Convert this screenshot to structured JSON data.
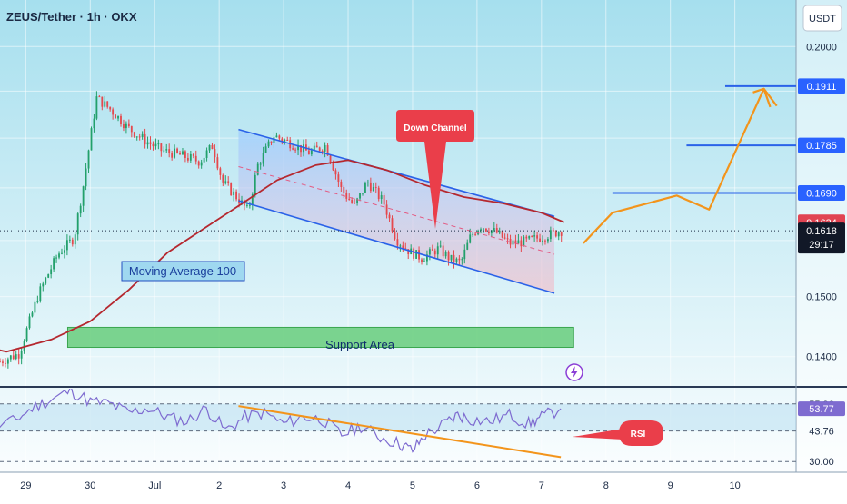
{
  "header": {
    "symbol_title": "ZEUS/Tether · 1h · OKX",
    "currency_button": "USDT"
  },
  "colors": {
    "background_top": "#a6dfee",
    "background_bottom": "#ffffff",
    "candle_up": "#22a06b",
    "candle_down": "#e5484d",
    "moving_average": "#b5282f",
    "channel_line": "#2a62e8",
    "channel_fill_top": "#9ecfff",
    "channel_fill_bottom": "#f5b9c4",
    "support_fill": "#6fcf83",
    "projection": "#f3941b",
    "rsi_line": "#7e6bd0",
    "callout_red": "#ea3e4a",
    "price_tag_red": "#e14452",
    "price_tag_blue": "#2962ff"
  },
  "annotations": {
    "down_channel": "Down Channel",
    "moving_average": "Moving Average 100",
    "support_area": "Support Area",
    "rsi": "RSI",
    "countdown": "29:17"
  },
  "chart_data": [
    {
      "type": "candlestick",
      "title": "ZEUS/Tether · 1h · OKX",
      "x_ticks": [
        "29",
        "30",
        "Jul",
        "2",
        "3",
        "4",
        "5",
        "6",
        "7",
        "8",
        "9",
        "10"
      ],
      "y_ticks": [
        "0.1400",
        "0.1500",
        "0.2000"
      ],
      "ylim": [
        0.1355,
        0.211
      ],
      "y_scale": "log",
      "grid": true,
      "price_levels": [
        {
          "label": "0.1911",
          "value": 0.1911,
          "style": "resistance-line"
        },
        {
          "label": "0.1785",
          "value": 0.1785,
          "style": "resistance-line"
        },
        {
          "label": "0.1690",
          "value": 0.169,
          "style": "resistance-line"
        },
        {
          "label": "0.1634",
          "value": 0.1634,
          "style": "moving-average-tag"
        },
        {
          "label": "0.1618",
          "value": 0.1618,
          "style": "last-price"
        }
      ],
      "close_path": [
        [
          28.6,
          0.1392
        ],
        [
          28.9,
          0.1405
        ],
        [
          29.2,
          0.1505
        ],
        [
          29.5,
          0.1575
        ],
        [
          29.75,
          0.1605
        ],
        [
          29.9,
          0.171
        ],
        [
          30.1,
          0.1885
        ],
        [
          30.3,
          0.1862
        ],
        [
          30.6,
          0.182
        ],
        [
          30.85,
          0.1795
        ],
        [
          31.1,
          0.1775
        ],
        [
          31.4,
          0.1765
        ],
        [
          31.7,
          0.1752
        ],
        [
          31.9,
          0.1785
        ],
        [
          32.05,
          0.1712
        ],
        [
          32.25,
          0.1685
        ],
        [
          32.45,
          0.1655
        ],
        [
          32.6,
          0.1745
        ],
        [
          32.85,
          0.1805
        ],
        [
          33.1,
          0.179
        ],
        [
          33.4,
          0.177
        ],
        [
          33.65,
          0.1785
        ],
        [
          33.9,
          0.1695
        ],
        [
          34.1,
          0.1665
        ],
        [
          34.3,
          0.1712
        ],
        [
          34.55,
          0.1672
        ],
        [
          34.75,
          0.1602
        ],
        [
          34.95,
          0.158
        ],
        [
          35.15,
          0.1568
        ],
        [
          35.4,
          0.1585
        ],
        [
          35.6,
          0.1565
        ],
        [
          35.75,
          0.156
        ],
        [
          35.9,
          0.1608
        ],
        [
          36.05,
          0.1628
        ],
        [
          36.3,
          0.1615
        ],
        [
          36.5,
          0.1595
        ],
        [
          36.75,
          0.1598
        ],
        [
          36.95,
          0.1605
        ],
        [
          37.15,
          0.1612
        ],
        [
          37.3,
          0.1618
        ]
      ],
      "moving_average_100_path": [
        [
          28.0,
          0.1424
        ],
        [
          28.7,
          0.1408
        ],
        [
          29.4,
          0.1428
        ],
        [
          30.0,
          0.1458
        ],
        [
          30.6,
          0.1512
        ],
        [
          31.2,
          0.1578
        ],
        [
          31.8,
          0.1625
        ],
        [
          32.3,
          0.1665
        ],
        [
          32.9,
          0.1715
        ],
        [
          33.5,
          0.1745
        ],
        [
          34.0,
          0.1755
        ],
        [
          34.6,
          0.1735
        ],
        [
          35.2,
          0.1705
        ],
        [
          35.8,
          0.1682
        ],
        [
          36.4,
          0.167
        ],
        [
          37.0,
          0.1652
        ],
        [
          37.35,
          0.1634
        ]
      ],
      "down_channel": {
        "upper": [
          [
            32.3,
            0.1818
          ],
          [
            37.2,
            0.1645
          ]
        ],
        "middle": [
          [
            32.3,
            0.1742
          ],
          [
            37.2,
            0.1575
          ]
        ],
        "lower": [
          [
            32.3,
            0.1675
          ],
          [
            37.2,
            0.1506
          ]
        ]
      },
      "support_area": {
        "x": [
          29.65,
          37.5
        ],
        "y": [
          0.1415,
          0.1448
        ]
      },
      "projection_path": [
        [
          37.65,
          0.1595
        ],
        [
          38.1,
          0.1652
        ],
        [
          39.1,
          0.1685
        ],
        [
          39.6,
          0.1658
        ],
        [
          40.45,
          0.1905
        ],
        [
          40.65,
          0.1868
        ]
      ]
    },
    {
      "type": "line",
      "series": [
        {
          "values": [
            [
              28.0,
              47
            ],
            [
              28.4,
              45
            ],
            [
              28.8,
              48
            ],
            [
              29.1,
              54
            ],
            [
              29.4,
              58
            ],
            [
              29.7,
              62
            ],
            [
              30.0,
              57
            ],
            [
              30.3,
              56
            ],
            [
              30.6,
              52
            ],
            [
              30.9,
              54
            ],
            [
              31.2,
              50
            ],
            [
              31.5,
              48
            ],
            [
              31.8,
              54
            ],
            [
              32.1,
              44
            ],
            [
              32.4,
              50
            ],
            [
              32.7,
              52
            ],
            [
              33.0,
              47
            ],
            [
              33.3,
              50
            ],
            [
              33.6,
              49
            ],
            [
              33.9,
              42
            ],
            [
              34.2,
              46
            ],
            [
              34.5,
              41
            ],
            [
              34.8,
              38
            ],
            [
              35.0,
              35
            ],
            [
              35.2,
              42
            ],
            [
              35.5,
              47
            ],
            [
              35.7,
              51
            ],
            [
              35.9,
              49
            ],
            [
              36.2,
              48
            ],
            [
              36.5,
              51
            ],
            [
              36.8,
              47
            ],
            [
              37.0,
              50
            ],
            [
              37.3,
              53.77
            ]
          ]
        }
      ],
      "y_ticks": [
        "55.96",
        "53.77",
        "43.76",
        "30.00"
      ],
      "ylim": [
        26,
        62
      ],
      "trendline": [
        [
          32.3,
          55.0
        ],
        [
          37.3,
          32.0
        ]
      ]
    }
  ]
}
